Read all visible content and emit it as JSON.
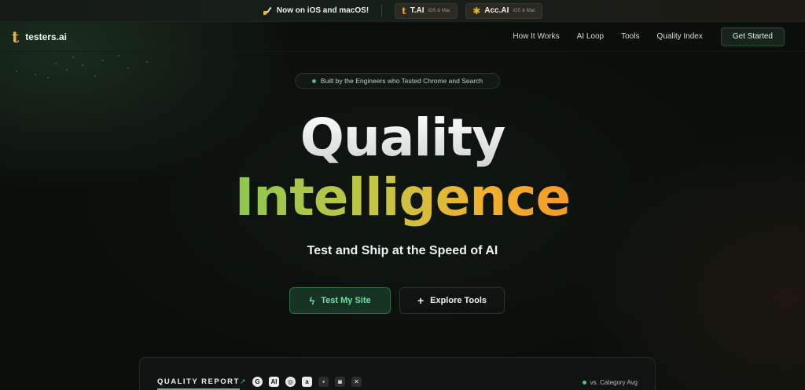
{
  "announcement": {
    "text": "Now on iOS and macOS!",
    "apps": [
      {
        "name": "T.AI",
        "platform": "iOS & Mac",
        "icon": "t-logo-icon"
      },
      {
        "name": "Acc.AI",
        "platform": "iOS & Mac",
        "icon": "accessibility-icon"
      }
    ]
  },
  "nav": {
    "brand": "testers.ai",
    "links": [
      "How It Works",
      "AI Loop",
      "Tools",
      "Quality Index"
    ],
    "cta": "Get Started"
  },
  "hero": {
    "badge": "Built by the Engineers who Tested Chrome and Search",
    "title_line1": "Quality",
    "title_line2": "Intelligence",
    "tagline": "Test and Ship at the Speed of AI",
    "primary_button": "Test My Site",
    "secondary_button": "Explore Tools"
  },
  "report": {
    "title": "QUALITY REPORT",
    "icons": [
      "G",
      "AI",
      "◎",
      "a",
      "▪",
      "◙",
      "✕"
    ],
    "legend": "vs. Category Avg"
  },
  "colors": {
    "accent_green": "#4fc27a",
    "accent_gold": "#f0b429",
    "background": "#0b0f0c"
  }
}
